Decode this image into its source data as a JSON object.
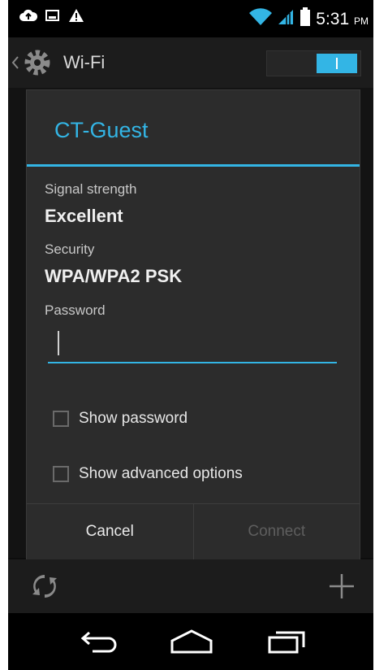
{
  "status_bar": {
    "time": "5:31",
    "ampm": "PM",
    "left_icons": [
      "cloud-upload-icon",
      "image-icon",
      "warning-icon"
    ],
    "right_icons": [
      "wifi-icon",
      "signal-icon",
      "battery-icon"
    ]
  },
  "action_bar": {
    "title": "Wi-Fi",
    "wifi_toggle": "on"
  },
  "dialog": {
    "title": "CT-Guest",
    "signal_label": "Signal strength",
    "signal_value": "Excellent",
    "security_label": "Security",
    "security_value": "WPA/WPA2 PSK",
    "password_label": "Password",
    "password_value": "",
    "show_password_label": "Show password",
    "show_password_checked": false,
    "show_advanced_label": "Show advanced options",
    "show_advanced_checked": false,
    "cancel_label": "Cancel",
    "connect_label": "Connect",
    "connect_enabled": false
  },
  "bottom_bar": {
    "left_icon": "wps-icon",
    "right_icon": "add-icon"
  },
  "nav_bar": {
    "buttons": [
      "back-icon",
      "home-icon",
      "recents-icon"
    ]
  },
  "colors": {
    "accent": "#33b5e5",
    "dialog_bg": "#2c2c2c",
    "disabled_text": "#5e5e5e"
  }
}
